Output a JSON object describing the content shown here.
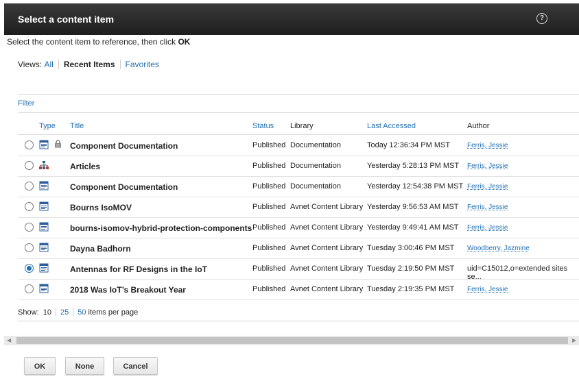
{
  "dialog": {
    "title": "Select a content item",
    "help_label": "?"
  },
  "instructions": {
    "text": "Select the content item to reference, then click ",
    "ok_word": "OK"
  },
  "views": {
    "label": "Views:",
    "all": "All",
    "recent": "Recent Items",
    "favorites": "Favorites"
  },
  "filter_label": "Filter",
  "columns": {
    "type": "Type",
    "title": "Title",
    "status": "Status",
    "library": "Library",
    "last_accessed": "Last Accessed",
    "author": "Author"
  },
  "rows": [
    {
      "icon": "document-icon",
      "locked": true,
      "title": "Component Documentation",
      "status": "Published",
      "library": "Documentation",
      "accessed": "Today 12:36:34 PM MST",
      "author": "Ferris, Jessie",
      "selected": false
    },
    {
      "icon": "site-area-icon",
      "locked": false,
      "title": "Articles",
      "status": "Published",
      "library": "Documentation",
      "accessed": "Yesterday 5:28:13 PM MST",
      "author": "Ferris, Jessie",
      "selected": false
    },
    {
      "icon": "document-icon",
      "locked": false,
      "title": "Component Documentation",
      "status": "Published",
      "library": "Documentation",
      "accessed": "Yesterday 12:54:38 PM MST",
      "author": "Ferris, Jessie",
      "selected": false
    },
    {
      "icon": "document-icon",
      "locked": false,
      "title": "Bourns IsoMOV",
      "status": "Published",
      "library": "Avnet Content Library",
      "accessed": "Yesterday 9:56:53 AM MST",
      "author": "Ferris, Jessie",
      "selected": false
    },
    {
      "icon": "document-icon",
      "locked": false,
      "title": "bourns-isomov-hybrid-protection-components",
      "status": "Published",
      "library": "Avnet Content Library",
      "accessed": "Yesterday 9:49:41 AM MST",
      "author": "Ferris, Jessie",
      "selected": false
    },
    {
      "icon": "document-icon",
      "locked": false,
      "title": "Dayna Badhorn",
      "status": "Published",
      "library": "Avnet Content Library",
      "accessed": "Tuesday 3:00:46 PM MST",
      "author": "Woodberry, Jazmine",
      "selected": false
    },
    {
      "icon": "document-icon",
      "locked": false,
      "title": "Antennas for RF Designs in the IoT",
      "status": "Published",
      "library": "Avnet Content Library",
      "accessed": "Tuesday 2:19:50 PM MST",
      "author": "uid=C15012,o=extended sites se...",
      "author_plain": true,
      "selected": true
    },
    {
      "icon": "document-icon",
      "locked": false,
      "title": "2018 Was IoT’s Breakout Year",
      "status": "Published",
      "library": "Avnet Content Library",
      "accessed": "Tuesday 2:19:35 PM MST",
      "author": "Ferris, Jessie",
      "selected": false
    }
  ],
  "paging": {
    "show_label": "Show:",
    "opt1": "10",
    "opt2": "25",
    "opt3": "50",
    "suffix": "items per page"
  },
  "buttons": {
    "ok": "OK",
    "none": "None",
    "cancel": "Cancel"
  }
}
